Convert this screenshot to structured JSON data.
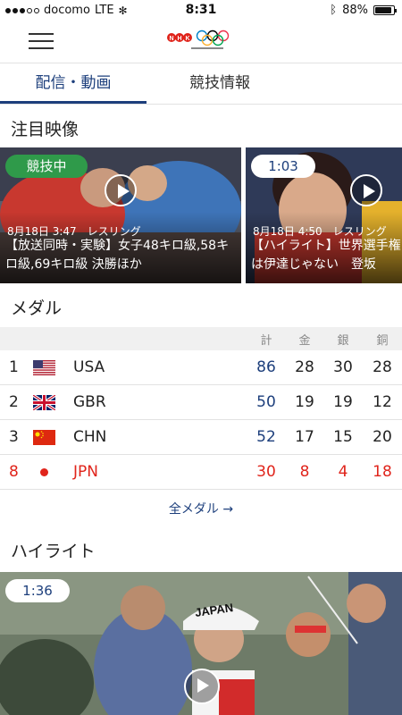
{
  "status_bar": {
    "carrier": "docomo",
    "network": "LTE",
    "time": "8:31",
    "battery": "88%",
    "battery_level": 0.88
  },
  "header": {
    "menu_icon": "hamburger-icon",
    "logo": "nhk-olympic-logo"
  },
  "tabs": [
    {
      "label": "配信・動画",
      "active": true
    },
    {
      "label": "競技情報",
      "active": false
    }
  ],
  "featured": {
    "title": "注目映像",
    "items": [
      {
        "badge": "競技中",
        "meta": "8月18日 3:47　レスリング",
        "title": "【放送同時・実験】女子48キロ級,58キロ級,69キロ級 決勝ほか"
      },
      {
        "badge": "1:03",
        "meta": "8月18日 4:50　レスリング",
        "title": "【ハイライト】世界選手権は伊達じゃない　登坂"
      }
    ]
  },
  "medals": {
    "title": "メダル",
    "headers": {
      "total": "計",
      "gold": "金",
      "silver": "銀",
      "bronze": "銅"
    },
    "rows": [
      {
        "rank": "1",
        "country": "USA",
        "total": "86",
        "gold": "28",
        "silver": "30",
        "bronze": "28"
      },
      {
        "rank": "2",
        "country": "GBR",
        "total": "50",
        "gold": "19",
        "silver": "19",
        "bronze": "12"
      },
      {
        "rank": "3",
        "country": "CHN",
        "total": "52",
        "gold": "17",
        "silver": "15",
        "bronze": "20"
      },
      {
        "rank": "8",
        "country": "JPN",
        "total": "30",
        "gold": "8",
        "silver": "4",
        "bronze": "18"
      }
    ],
    "all_link": "全メダル →"
  },
  "highlight": {
    "title": "ハイライト",
    "duration": "1:36",
    "cap_text": "JAPAN"
  },
  "colors": {
    "accent": "#1d3f7c",
    "live": "#2f9a4a",
    "japan": "#e0241b"
  }
}
